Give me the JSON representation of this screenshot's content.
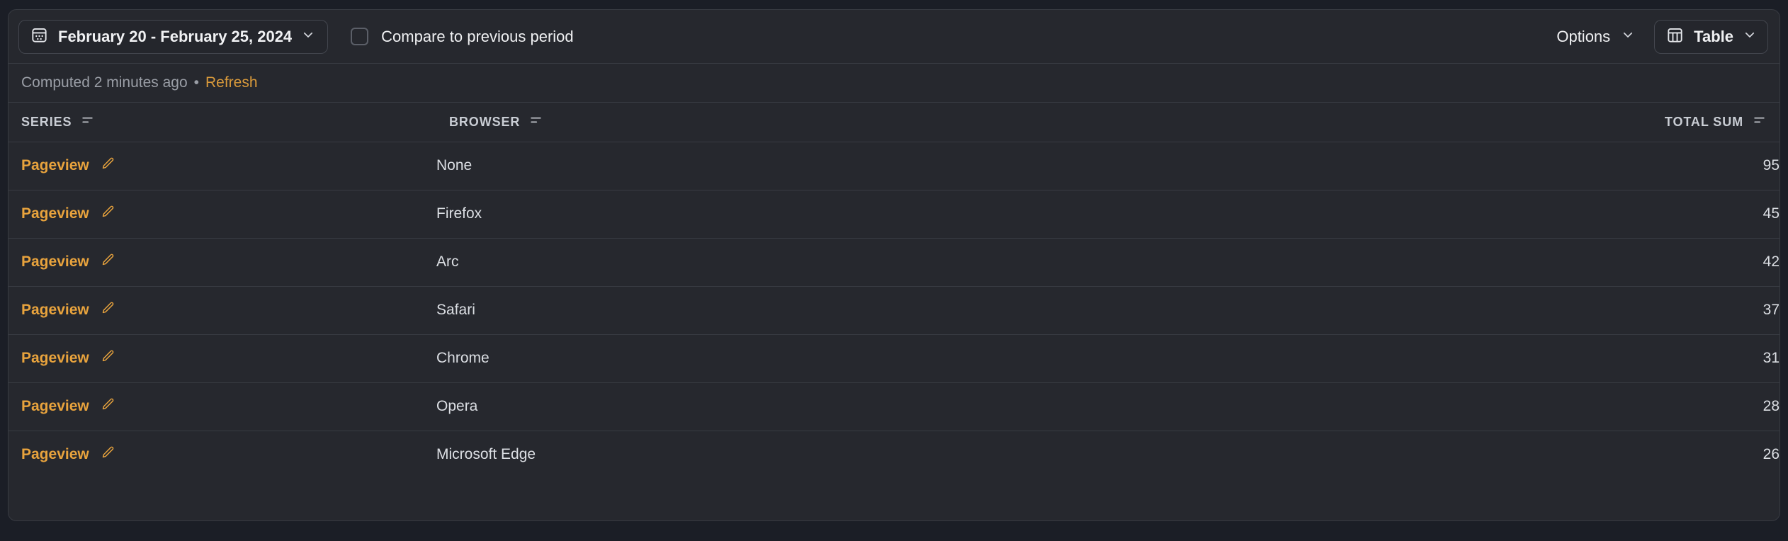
{
  "toolbar": {
    "date_range": "February 20 - February 25, 2024",
    "calendar_icon": "calendar-icon",
    "date_chevron_icon": "chevron-down-icon",
    "compare_label": "Compare to previous period",
    "compare_checked": false,
    "options_label": "Options",
    "options_chevron_icon": "chevron-down-icon",
    "view_label": "Table",
    "view_icon": "table-icon",
    "view_chevron_icon": "chevron-down-icon"
  },
  "status": {
    "computed_text": "Computed 2 minutes ago",
    "separator": "•",
    "refresh_label": "Refresh"
  },
  "table": {
    "columns": [
      {
        "label": "SERIES",
        "sort_icon": "sort-descending-icon",
        "align": "left"
      },
      {
        "label": "BROWSER",
        "sort_icon": "sort-descending-icon",
        "align": "left"
      },
      {
        "label": "TOTAL SUM",
        "sort_icon": "sort-descending-icon",
        "align": "right"
      }
    ],
    "rows": [
      {
        "series": "Pageview",
        "edit_icon": "pencil-icon",
        "browser": "None",
        "total_sum": "95"
      },
      {
        "series": "Pageview",
        "edit_icon": "pencil-icon",
        "browser": "Firefox",
        "total_sum": "45"
      },
      {
        "series": "Pageview",
        "edit_icon": "pencil-icon",
        "browser": "Arc",
        "total_sum": "42"
      },
      {
        "series": "Pageview",
        "edit_icon": "pencil-icon",
        "browser": "Safari",
        "total_sum": "37"
      },
      {
        "series": "Pageview",
        "edit_icon": "pencil-icon",
        "browser": "Chrome",
        "total_sum": "31"
      },
      {
        "series": "Pageview",
        "edit_icon": "pencil-icon",
        "browser": "Opera",
        "total_sum": "28"
      },
      {
        "series": "Pageview",
        "edit_icon": "pencil-icon",
        "browser": "Microsoft Edge",
        "total_sum": "26"
      }
    ]
  },
  "colors": {
    "accent": "#e8a33d",
    "link": "#d99a3b",
    "page_bg": "#1b1e26",
    "panel_bg": "#26282e",
    "border": "#383b42",
    "text": "#f0f1f3",
    "muted": "#9a9ea6"
  },
  "chart_data": {
    "type": "table",
    "title": "",
    "categories": [
      "None",
      "Firefox",
      "Arc",
      "Safari",
      "Chrome",
      "Opera",
      "Microsoft Edge"
    ],
    "series": [
      {
        "name": "Pageview",
        "values": [
          95,
          45,
          42,
          37,
          31,
          28,
          26
        ]
      }
    ],
    "xlabel": "BROWSER",
    "ylabel": "TOTAL SUM",
    "legend": [
      "Pageview"
    ],
    "grid": true
  }
}
